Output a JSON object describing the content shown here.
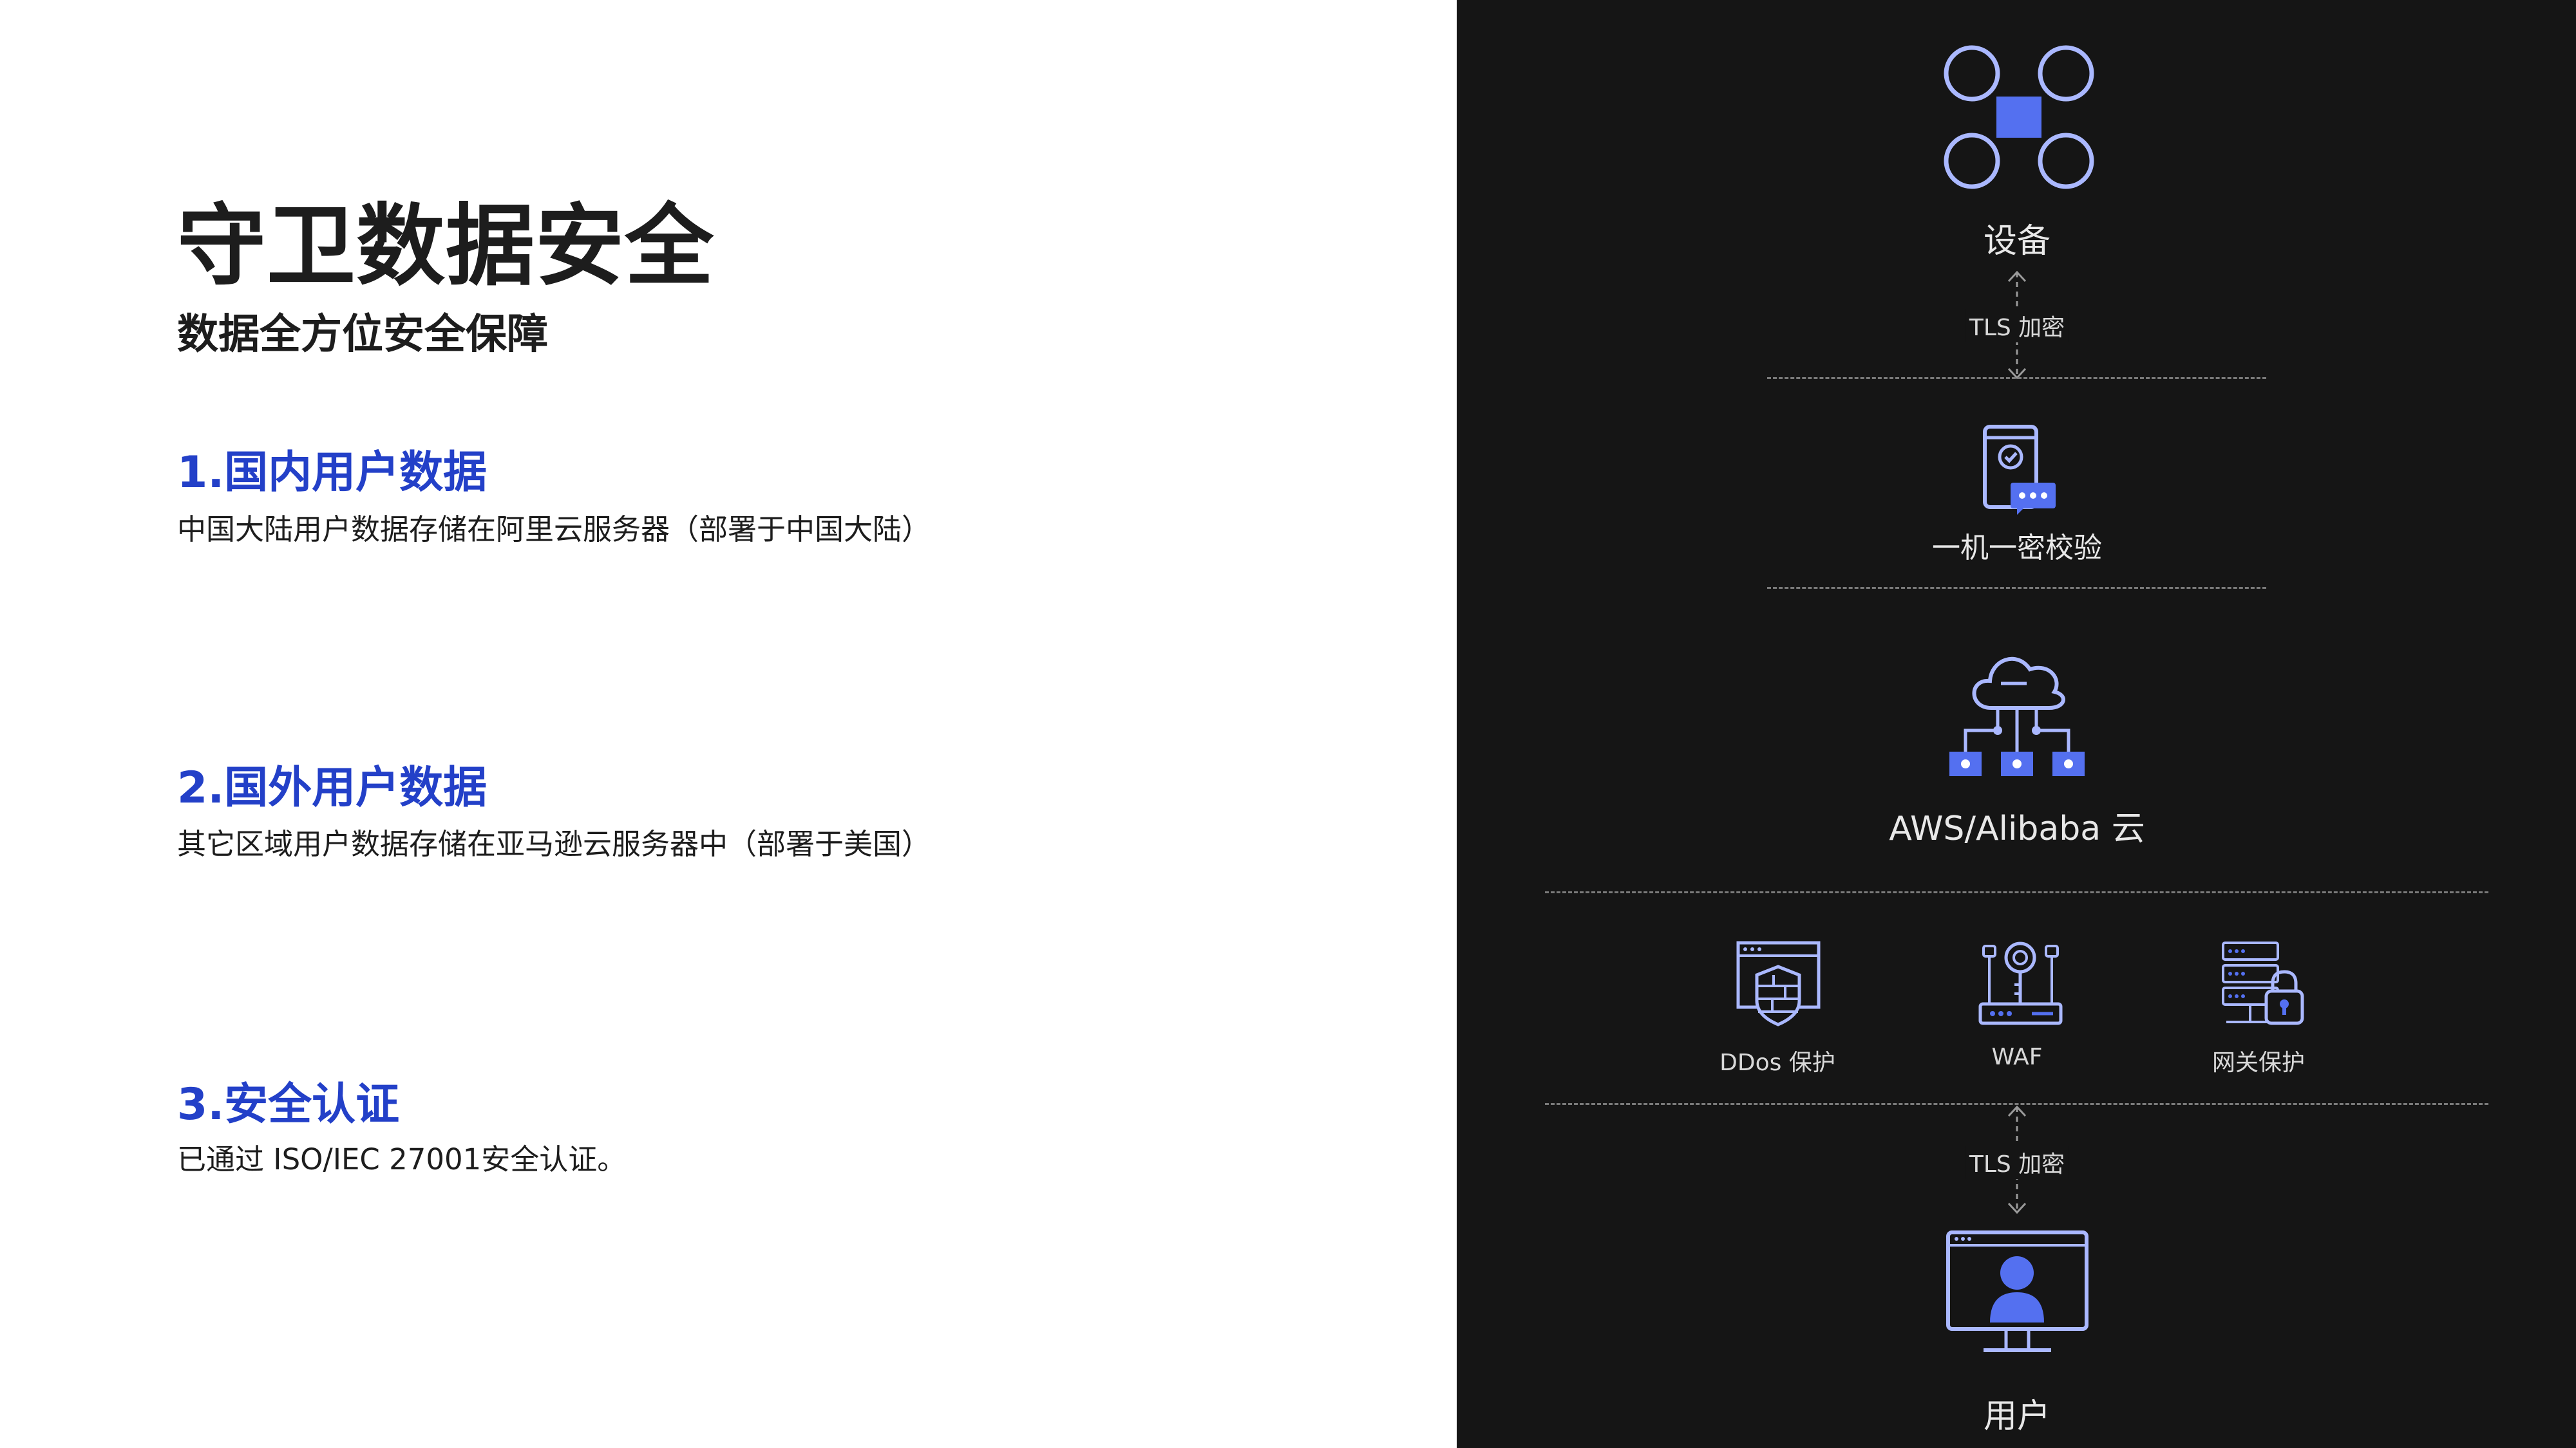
{
  "left": {
    "title": "守卫数据安全",
    "subtitle": "数据全方位安全保障",
    "sections": [
      {
        "heading": "1.国内用户数据",
        "body": "中国大陆用户数据存储在阿里云服务器（部署于中国大陆）"
      },
      {
        "heading": "2.国外用户数据",
        "body": "其它区域用户数据存储在亚马逊云服务器中（部署于美国）"
      },
      {
        "heading": "3.安全认证",
        "body": "已通过 ISO/IEC 27001安全认证。"
      }
    ]
  },
  "diagram": {
    "device_label": "设备",
    "link_top_label": "TLS 加密",
    "verify_label": "一机一密校验",
    "cloud_label": "AWS/Alibaba 云",
    "protections": [
      {
        "label": "DDos 保护",
        "icon": "firewall-shield-icon"
      },
      {
        "label": "WAF",
        "icon": "waf-device-icon"
      },
      {
        "label": "网关保护",
        "icon": "server-lock-icon"
      }
    ],
    "link_bottom_label": "TLS 加密",
    "user_label": "用户",
    "colors": {
      "accent": "#5470f0",
      "icon_stroke": "#aab8ff",
      "left_heading": "#2340c8",
      "panel_bg": "#151515"
    }
  }
}
